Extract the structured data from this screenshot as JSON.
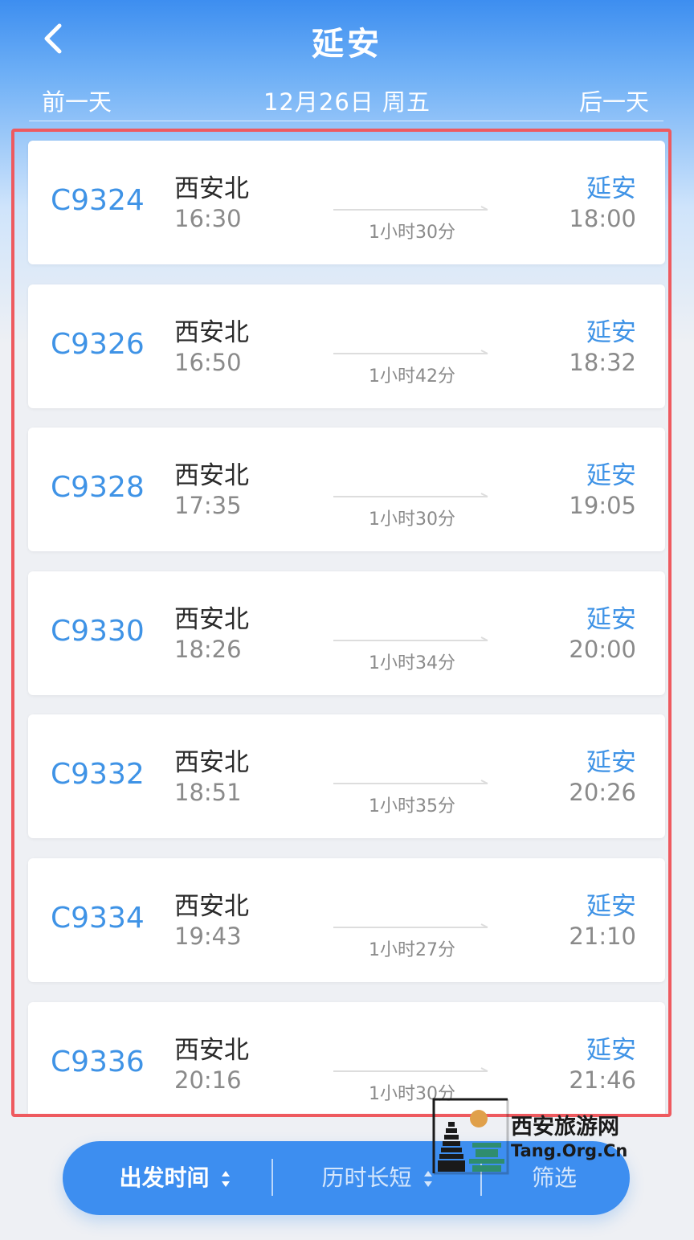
{
  "header": {
    "title": "延安",
    "prev_day": "前一天",
    "current_date": "12月26日 周五",
    "next_day": "后一天"
  },
  "trains": [
    {
      "no": "C9324",
      "from": "西安北",
      "dep": "16:30",
      "duration": "1小时30分",
      "to": "延安",
      "arr": "18:00"
    },
    {
      "no": "C9326",
      "from": "西安北",
      "dep": "16:50",
      "duration": "1小时42分",
      "to": "延安",
      "arr": "18:32"
    },
    {
      "no": "C9328",
      "from": "西安北",
      "dep": "17:35",
      "duration": "1小时30分",
      "to": "延安",
      "arr": "19:05"
    },
    {
      "no": "C9330",
      "from": "西安北",
      "dep": "18:26",
      "duration": "1小时34分",
      "to": "延安",
      "arr": "20:00"
    },
    {
      "no": "C9332",
      "from": "西安北",
      "dep": "18:51",
      "duration": "1小时35分",
      "to": "延安",
      "arr": "20:26"
    },
    {
      "no": "C9334",
      "from": "西安北",
      "dep": "19:43",
      "duration": "1小时27分",
      "to": "延安",
      "arr": "21:10"
    },
    {
      "no": "C9336",
      "from": "西安北",
      "dep": "20:16",
      "duration": "1小时30分",
      "to": "延安",
      "arr": "21:46"
    }
  ],
  "filter_bar": {
    "sort_departure": "出发时间",
    "sort_duration": "历时长短",
    "filter": "筛选"
  },
  "watermark": {
    "site_name": "西安旅游网",
    "domain": "Tang.Org.Cn"
  },
  "colors": {
    "primary": "#3d8ef0",
    "accent_text": "#3f93e6",
    "highlight": "#ee5a5f"
  }
}
